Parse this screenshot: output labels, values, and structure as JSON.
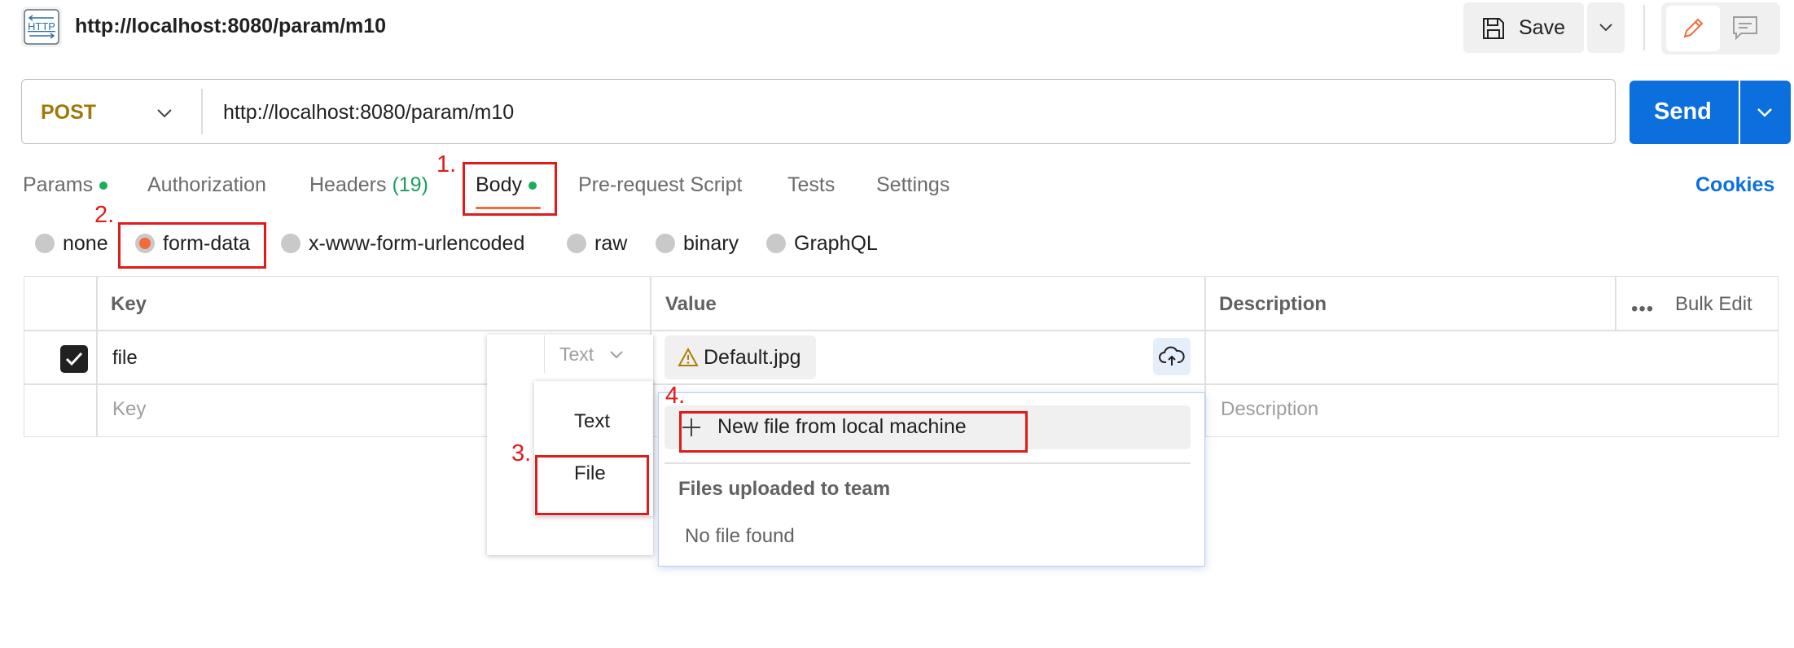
{
  "header": {
    "title": "http://localhost:8080/param/m10",
    "icon_label": "HTTP",
    "save_label": "Save"
  },
  "request": {
    "method": "POST",
    "url": "http://localhost:8080/param/m10",
    "send_label": "Send"
  },
  "tabs": {
    "params": "Params",
    "authorization": "Authorization",
    "headers": "Headers",
    "headers_count": "(19)",
    "body": "Body",
    "prerequest": "Pre-request Script",
    "tests": "Tests",
    "settings": "Settings",
    "cookies": "Cookies"
  },
  "body_types": {
    "none": "none",
    "form_data": "form-data",
    "urlencoded": "x-www-form-urlencoded",
    "raw": "raw",
    "binary": "binary",
    "graphql": "GraphQL",
    "selected": "form-data"
  },
  "table": {
    "headers": {
      "key": "Key",
      "value": "Value",
      "description": "Description",
      "bulk_edit": "Bulk Edit",
      "more": "•••"
    },
    "rows": [
      {
        "checked": true,
        "key": "file",
        "type": "Text",
        "value": "Default.jpg"
      }
    ],
    "placeholders": {
      "key": "Key",
      "description": "Description"
    }
  },
  "type_menu": {
    "options": [
      "Text",
      "File"
    ]
  },
  "file_popup": {
    "new_file": "New file from local machine",
    "section_title": "Files uploaded to team",
    "empty": "No file found"
  },
  "annotations": [
    "1.",
    "2.",
    "3.",
    "4."
  ],
  "colors": {
    "accent_orange": "#f26b3a",
    "send_blue": "#0b6fde",
    "method_gold": "#a0780a",
    "annotation_red": "#e01b1b",
    "status_green": "#1aae5a"
  }
}
